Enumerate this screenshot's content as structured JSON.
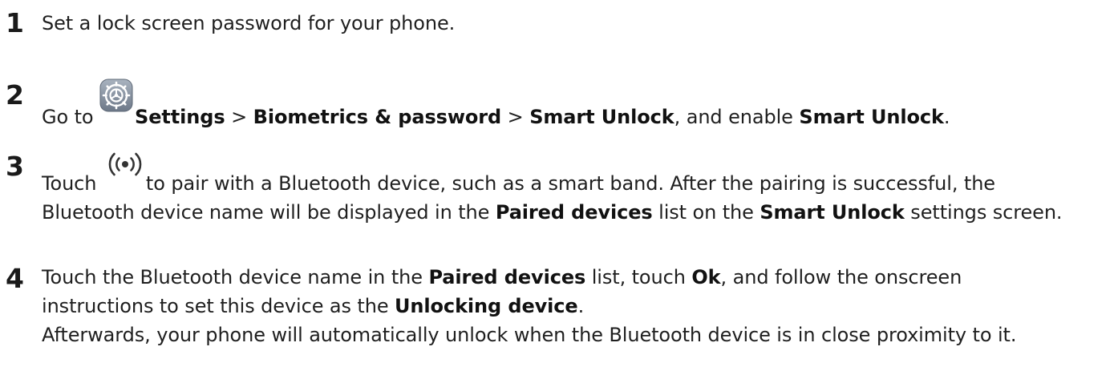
{
  "steps": [
    {
      "number": "1",
      "text": "Set a lock screen password for your phone."
    },
    {
      "number": "2",
      "pre": "Go to",
      "settings": "Settings",
      "sep1": " > ",
      "biometrics": "Biometrics & password",
      "sep2": " > ",
      "smart_unlock_1": "Smart Unlock",
      "mid": ", and enable ",
      "smart_unlock_2": "Smart Unlock",
      "end": "."
    },
    {
      "number": "3",
      "pre": "Touch",
      "post": "to pair with a Bluetooth device, such as a smart band. After the pairing is successful, the Bluetooth device name will be displayed in the ",
      "paired_devices": "Paired devices",
      "mid": " list on the ",
      "smart_unlock": "Smart Unlock",
      "end": " settings screen."
    },
    {
      "number": "4",
      "pre": "Touch the Bluetooth device name in the ",
      "paired_devices": "Paired devices",
      "mid1": " list, touch ",
      "ok": "Ok",
      "mid2": ", and follow the onscreen instructions to set this device as the ",
      "unlocking_device": "Unlocking device",
      "end": ".",
      "followup": "Afterwards, your phone will automatically unlock when the Bluetooth device is in close proximity to it."
    }
  ],
  "icons": {
    "settings": "settings-gear-icon",
    "bluetooth": "bluetooth-signal-icon"
  },
  "colors": {
    "text": "#1f1f1f",
    "settings_icon_bg": "#7f8a99"
  }
}
